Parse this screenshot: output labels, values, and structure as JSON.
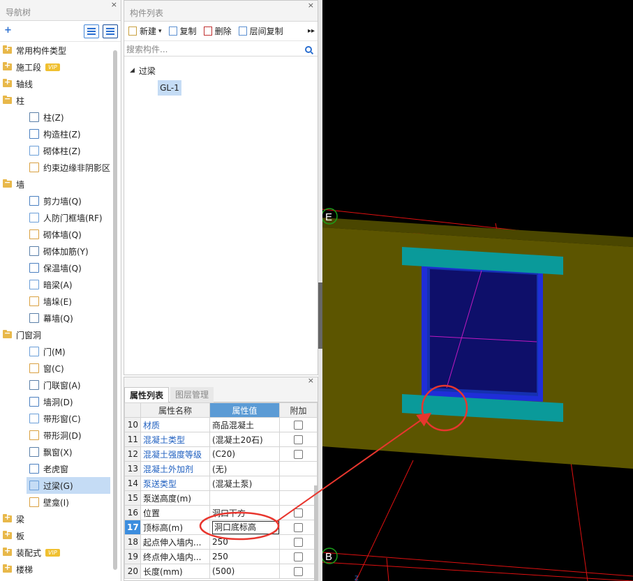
{
  "nav": {
    "title": "导航树",
    "close": "×",
    "add_icon": "+",
    "categories": [
      {
        "label": "常用构件类型"
      },
      {
        "label": "施工段",
        "badge": "VIP"
      },
      {
        "label": "轴线"
      },
      {
        "label": "柱",
        "children": [
          "柱(Z)",
          "构造柱(Z)",
          "砌体柱(Z)",
          "约束边缘非阴影区"
        ]
      },
      {
        "label": "墙",
        "children": [
          "剪力墙(Q)",
          "人防门框墙(RF)",
          "砌体墙(Q)",
          "砌体加筋(Y)",
          "保温墙(Q)",
          "暗梁(A)",
          "墙垛(E)",
          "幕墙(Q)"
        ]
      },
      {
        "label": "门窗洞",
        "children": [
          "门(M)",
          "窗(C)",
          "门联窗(A)",
          "墙洞(D)",
          "带形窗(C)",
          "带形洞(D)",
          "飘窗(X)",
          "老虎窗",
          "过梁(G)",
          "壁龛(I)"
        ]
      },
      {
        "label": "梁"
      },
      {
        "label": "板"
      },
      {
        "label": "装配式",
        "badge": "VIP"
      },
      {
        "label": "楼梯"
      }
    ],
    "selected": "过梁(G)"
  },
  "complist": {
    "title": "构件列表",
    "close": "×",
    "toolbar": {
      "new": "新建",
      "new_arrow": "▾",
      "copy": "复制",
      "delete": "删除",
      "floor_copy": "层间复制",
      "more": "▸▸"
    },
    "search_placeholder": "搜索构件...",
    "group": "过梁",
    "group_arrow": "◢",
    "item": "GL-1"
  },
  "props": {
    "tab_active": "属性列表",
    "tab_inactive": "图层管理",
    "close": "×",
    "headers": {
      "name": "属性名称",
      "value": "属性值",
      "extra": "附加"
    },
    "rows": [
      {
        "num": "10",
        "name": "材质",
        "value": "商品混凝土",
        "link": true,
        "check": true
      },
      {
        "num": "11",
        "name": "混凝土类型",
        "value": "(混凝土20石)",
        "link": true,
        "check": true
      },
      {
        "num": "12",
        "name": "混凝土强度等级",
        "value": "(C20)",
        "link": true,
        "check": true
      },
      {
        "num": "13",
        "name": "混凝土外加剂",
        "value": "(无)",
        "link": true,
        "check": false
      },
      {
        "num": "14",
        "name": "泵送类型",
        "value": "(混凝土泵)",
        "link": true,
        "check": false
      },
      {
        "num": "15",
        "name": "泵送高度(m)",
        "value": "",
        "link": false,
        "check": false
      },
      {
        "num": "16",
        "name": "位置",
        "value": "洞口下方",
        "link": false,
        "check": true
      },
      {
        "num": "17",
        "name": "顶标高(m)",
        "value": "洞口底标高",
        "link": false,
        "check": true,
        "current": true
      },
      {
        "num": "18",
        "name": "起点伸入墙内...",
        "value": "250",
        "link": false,
        "check": true
      },
      {
        "num": "19",
        "name": "终点伸入墙内...",
        "value": "250",
        "link": false,
        "check": true
      },
      {
        "num": "20",
        "name": "长度(mm)",
        "value": "(500)",
        "link": false,
        "check": true
      }
    ]
  },
  "viewport": {
    "axis_e": "E",
    "axis_b": "B",
    "axis_z": "Z",
    "colors": {
      "background": "#000000",
      "wall": "#5c5500",
      "wall_top": "#4a4600",
      "lintel": "#0a9a9a",
      "window_frame": "#1f2ed8",
      "window_glass": "#0e0f6a",
      "grid_line": "#e01010",
      "axis_circle": "#1aa01a",
      "annotation": "#e8362e"
    }
  }
}
